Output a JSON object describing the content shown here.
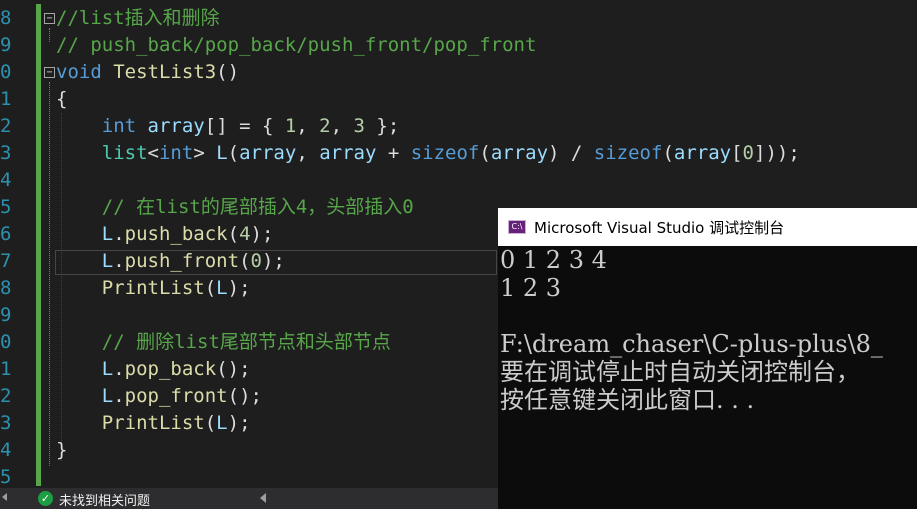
{
  "editor": {
    "line_numbers": [
      "8",
      "9",
      "0",
      "1",
      "2",
      "3",
      "4",
      "5",
      "6",
      "7",
      "8",
      "9",
      "0",
      "1",
      "2",
      "3",
      "4",
      "5"
    ],
    "lines": [
      [
        {
          "t": "//list插入和删除",
          "c": "comment"
        }
      ],
      [
        {
          "t": "// push_back/pop_back/push_front/pop_front",
          "c": "comment"
        }
      ],
      [
        {
          "t": "void",
          "c": "keyword"
        },
        {
          "t": " ",
          "c": "plain"
        },
        {
          "t": "TestList3",
          "c": "func"
        },
        {
          "t": "()",
          "c": "plain"
        }
      ],
      [
        {
          "t": "{",
          "c": "plain"
        }
      ],
      [
        {
          "t": "    ",
          "c": "plain"
        },
        {
          "t": "int",
          "c": "keyword"
        },
        {
          "t": " ",
          "c": "plain"
        },
        {
          "t": "array",
          "c": "var"
        },
        {
          "t": "[] = { ",
          "c": "plain"
        },
        {
          "t": "1",
          "c": "number"
        },
        {
          "t": ", ",
          "c": "plain"
        },
        {
          "t": "2",
          "c": "number"
        },
        {
          "t": ", ",
          "c": "plain"
        },
        {
          "t": "3",
          "c": "number"
        },
        {
          "t": " };",
          "c": "plain"
        }
      ],
      [
        {
          "t": "    ",
          "c": "plain"
        },
        {
          "t": "list",
          "c": "type"
        },
        {
          "t": "<",
          "c": "plain"
        },
        {
          "t": "int",
          "c": "keyword"
        },
        {
          "t": "> ",
          "c": "plain"
        },
        {
          "t": "L",
          "c": "var"
        },
        {
          "t": "(",
          "c": "plain"
        },
        {
          "t": "array",
          "c": "var"
        },
        {
          "t": ", ",
          "c": "plain"
        },
        {
          "t": "array",
          "c": "var"
        },
        {
          "t": " + ",
          "c": "plain"
        },
        {
          "t": "sizeof",
          "c": "keyword"
        },
        {
          "t": "(",
          "c": "plain"
        },
        {
          "t": "array",
          "c": "var"
        },
        {
          "t": ") / ",
          "c": "plain"
        },
        {
          "t": "sizeof",
          "c": "keyword"
        },
        {
          "t": "(",
          "c": "plain"
        },
        {
          "t": "array",
          "c": "var"
        },
        {
          "t": "[",
          "c": "plain"
        },
        {
          "t": "0",
          "c": "number"
        },
        {
          "t": "]));",
          "c": "plain"
        }
      ],
      [],
      [
        {
          "t": "    ",
          "c": "plain"
        },
        {
          "t": "// 在list的尾部插入4，头部插入0",
          "c": "comment"
        }
      ],
      [
        {
          "t": "    ",
          "c": "plain"
        },
        {
          "t": "L",
          "c": "var"
        },
        {
          "t": ".",
          "c": "plain"
        },
        {
          "t": "push_back",
          "c": "func"
        },
        {
          "t": "(",
          "c": "plain"
        },
        {
          "t": "4",
          "c": "number"
        },
        {
          "t": ");",
          "c": "plain"
        }
      ],
      [
        {
          "t": "    ",
          "c": "plain"
        },
        {
          "t": "L",
          "c": "var"
        },
        {
          "t": ".",
          "c": "plain"
        },
        {
          "t": "push_front",
          "c": "func"
        },
        {
          "t": "(",
          "c": "plain"
        },
        {
          "t": "0",
          "c": "number"
        },
        {
          "t": ");",
          "c": "plain"
        }
      ],
      [
        {
          "t": "    ",
          "c": "plain"
        },
        {
          "t": "PrintList",
          "c": "func"
        },
        {
          "t": "(",
          "c": "plain"
        },
        {
          "t": "L",
          "c": "var"
        },
        {
          "t": ");",
          "c": "plain"
        }
      ],
      [],
      [
        {
          "t": "    ",
          "c": "plain"
        },
        {
          "t": "// 删除list尾部节点和头部节点",
          "c": "comment"
        }
      ],
      [
        {
          "t": "    ",
          "c": "plain"
        },
        {
          "t": "L",
          "c": "var"
        },
        {
          "t": ".",
          "c": "plain"
        },
        {
          "t": "pop_back",
          "c": "func"
        },
        {
          "t": "();",
          "c": "plain"
        }
      ],
      [
        {
          "t": "    ",
          "c": "plain"
        },
        {
          "t": "L",
          "c": "var"
        },
        {
          "t": ".",
          "c": "plain"
        },
        {
          "t": "pop_front",
          "c": "func"
        },
        {
          "t": "();",
          "c": "plain"
        }
      ],
      [
        {
          "t": "    ",
          "c": "plain"
        },
        {
          "t": "PrintList",
          "c": "func"
        },
        {
          "t": "(",
          "c": "plain"
        },
        {
          "t": "L",
          "c": "var"
        },
        {
          "t": ");",
          "c": "plain"
        }
      ],
      [
        {
          "t": "}",
          "c": "plain"
        }
      ],
      []
    ]
  },
  "statusbar": {
    "issues_icon": "check-circle-icon",
    "issues_icon_glyph": "✓",
    "issues_text": "未找到相关问题"
  },
  "console": {
    "title": "Microsoft Visual Studio 调试控制台",
    "icon": "vs-console-icon",
    "icon_glyph": "C:\\",
    "lines": [
      "0 1 2 3 4",
      "1 2 3",
      "",
      "F:\\dream_chaser\\C-plus-plus\\8_",
      "要在调试停止时自动关闭控制台，",
      "按任意键关闭此窗口. . ."
    ]
  },
  "colors": {
    "line_number": "#2b91af",
    "comment": "#57a64a",
    "keyword": "#569cd6",
    "function": "#dcdcaa",
    "number": "#b5cea8",
    "variable": "#9cdcfe",
    "type": "#4ec9b0",
    "editor_bg": "#1e1e1e",
    "console_bg": "#0c0c0c"
  }
}
